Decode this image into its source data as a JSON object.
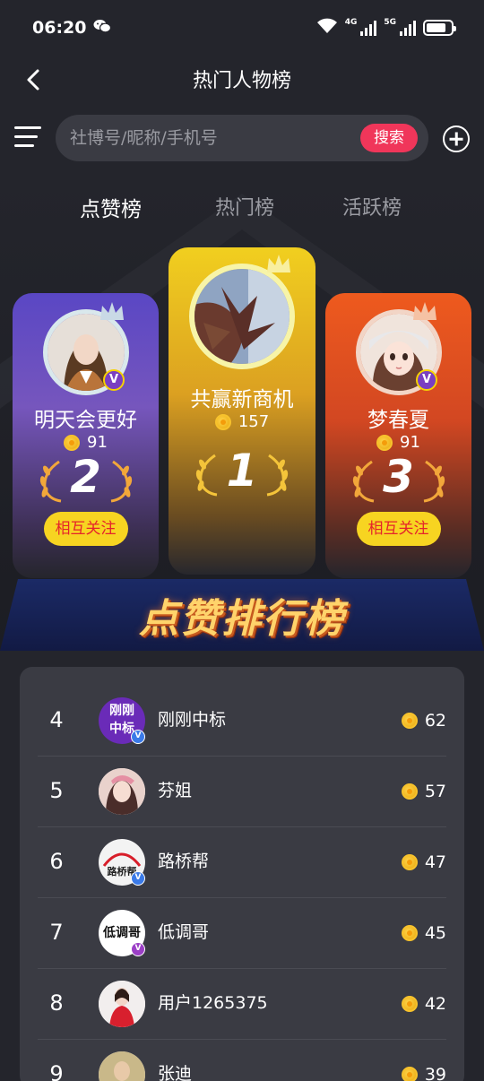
{
  "status": {
    "time": "06:20",
    "net1": "4G",
    "net2": "5G"
  },
  "header": {
    "title": "热门人物榜"
  },
  "search": {
    "placeholder": "社博号/昵称/手机号",
    "button_label": "搜索"
  },
  "tabs": [
    {
      "label": "点赞榜",
      "active": true
    },
    {
      "label": "热门榜",
      "active": false
    },
    {
      "label": "活跃榜",
      "active": false
    }
  ],
  "podium": {
    "first": {
      "name": "共赢新商机",
      "score": "157",
      "rank": "1"
    },
    "second": {
      "name": "明天会更好",
      "score": "91",
      "rank": "2",
      "follow_label": "相互关注",
      "badge": "V"
    },
    "third": {
      "name": "梦春夏",
      "score": "91",
      "rank": "3",
      "follow_label": "相互关注",
      "badge": "V"
    }
  },
  "banner": {
    "text": "点赞排行榜"
  },
  "ranking": [
    {
      "rank": "4",
      "name": "刚刚中标",
      "score": "62",
      "avatar_text_top": "刚刚",
      "avatar_text_bottom": "中标",
      "badge": "V"
    },
    {
      "rank": "5",
      "name": "芬姐",
      "score": "57"
    },
    {
      "rank": "6",
      "name": "路桥帮",
      "score": "47",
      "avatar_text_top": "路桥帮",
      "badge": "V"
    },
    {
      "rank": "7",
      "name": "低调哥",
      "score": "45",
      "avatar_text_top": "低调哥",
      "badge": "V"
    },
    {
      "rank": "8",
      "name": "用户1265375",
      "score": "42"
    },
    {
      "rank": "9",
      "name": "张迪",
      "score": "39"
    }
  ]
}
